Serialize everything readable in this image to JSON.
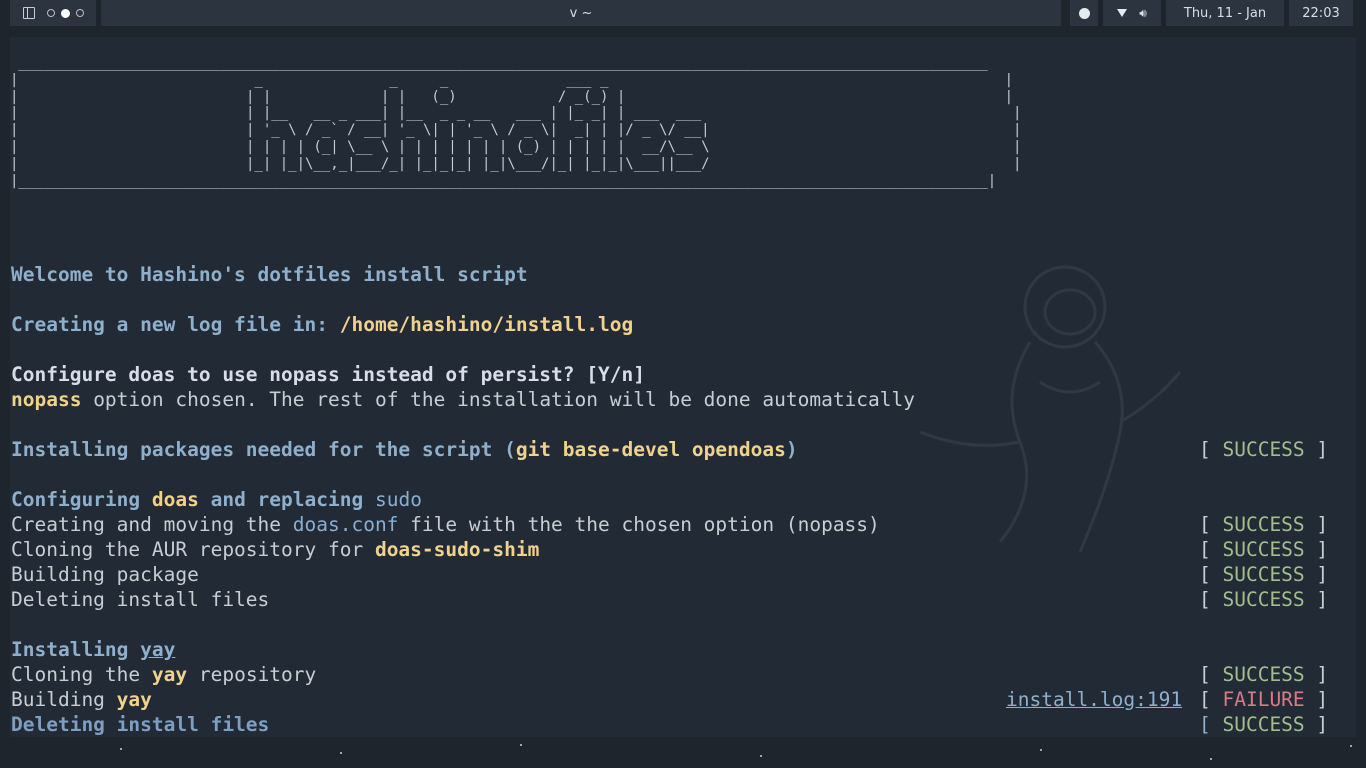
{
  "topbar": {
    "window_title": "v ~",
    "date": "Thu, 11 - Jan",
    "time": "22:03",
    "icons": [
      "sidebar-icon",
      "workspace-dots",
      "spotify-icon",
      "wifi-icon",
      "volume-icon"
    ]
  },
  "banner": {
    "ascii": " ___________________________________________________________________________________________________________________\n|                            _               _     _              ___ _                                               |\n|                           | |             | |   (_)            / _(_) |                                             |\n|                           | |__   __ _ ___| |__  _ _ __   ___ | |_ _| | ___  ___                                     |\n|                           | '_ \\ / _` / __| '_ \\| | '_ \\ / _ \\|  _| | |/ _ \\/ __|                                    |\n|                           | | | | (_| \\__ \\ | | | | | | | (_) | | | | |  __/\\__ \\                                    |\n|                           |_| |_|\\__,_|___/_| |_|_|_| |_|\\___/|_| |_|_|\\___||___/                                    |\n|___________________________________________________________________________________________________________________|"
  },
  "lines": {
    "welcome": "Welcome to Hashino's dotfiles install script",
    "log_prefix": "Creating a new log file in: ",
    "log_path": "/home/hashino/install.log",
    "configure_q": "Configure doas to use nopass instead of persist? [Y/n]",
    "nopass_word": "nopass",
    "nopass_rest": " option chosen. The rest of the installation will be done automatically",
    "pkgs_prefix": "Installing packages needed for the script (",
    "pkgs_list": "git base-devel opendoas",
    "pkgs_suffix": ")",
    "cfg_a": "Configuring ",
    "cfg_doas": "doas",
    "cfg_b": " and replacing ",
    "cfg_sudo": "sudo",
    "create_a": "Creating and moving the ",
    "create_conf": "doas.conf",
    "create_b": " file with the the chosen option (nopass)",
    "clone_aur_a": "Cloning the AUR repository for ",
    "clone_aur_pkg": "doas-sudo-shim",
    "building_pkg": "Building package",
    "deleting_1": "Deleting install files",
    "yay_a": "Installing ",
    "yay_b": "yay",
    "clone_yay_a": "Cloning the ",
    "clone_yay_b": "yay",
    "clone_yay_c": " repository",
    "build_yay_a": "Building ",
    "build_yay_b": "yay",
    "deleting_2": "Deleting install files",
    "log_ref": "install.log:191"
  },
  "status": {
    "open": "[ ",
    "close": " ]",
    "success": "SUCCESS",
    "failure": "FAILURE"
  },
  "colors": {
    "background": "#222b35",
    "heading": "#8fb0cd",
    "highlight": "#f0d28d",
    "success": "#a3be8c",
    "failure": "#d67c86"
  }
}
